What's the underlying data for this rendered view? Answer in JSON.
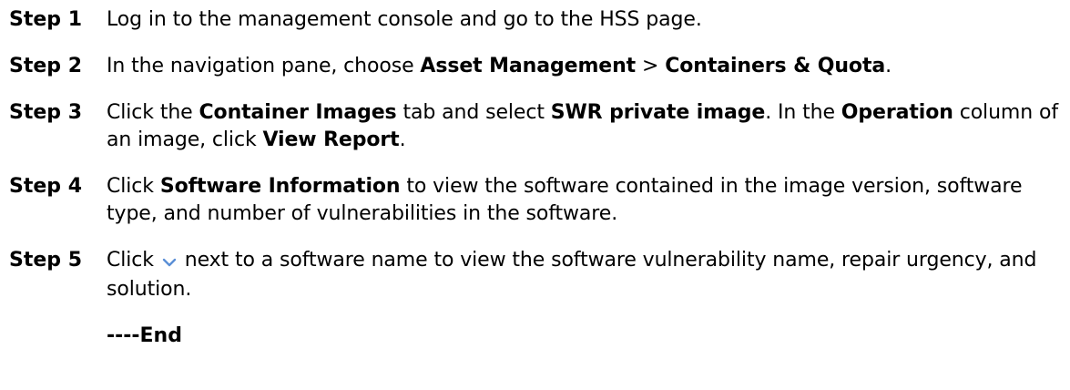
{
  "steps": [
    {
      "label": "Step 1",
      "parts": [
        {
          "t": "Log in to the management console and go to the HSS page.",
          "b": false
        }
      ]
    },
    {
      "label": "Step 2",
      "parts": [
        {
          "t": "In the navigation pane, choose ",
          "b": false
        },
        {
          "t": "Asset Management",
          "b": true
        },
        {
          "t": " > ",
          "b": false
        },
        {
          "t": "Containers & Quota",
          "b": true
        },
        {
          "t": ".",
          "b": false
        }
      ]
    },
    {
      "label": "Step 3",
      "parts": [
        {
          "t": "Click the ",
          "b": false
        },
        {
          "t": "Container Images",
          "b": true
        },
        {
          "t": " tab and select ",
          "b": false
        },
        {
          "t": "SWR private image",
          "b": true
        },
        {
          "t": ". In the ",
          "b": false
        },
        {
          "t": "Operation",
          "b": true
        },
        {
          "t": " column of an image, click ",
          "b": false
        },
        {
          "t": "View Report",
          "b": true
        },
        {
          "t": ".",
          "b": false
        }
      ]
    },
    {
      "label": "Step 4",
      "parts": [
        {
          "t": "Click ",
          "b": false
        },
        {
          "t": "Software Information",
          "b": true
        },
        {
          "t": " to view the software contained in the image version, software type, and number of vulnerabilities in the software.",
          "b": false
        }
      ]
    },
    {
      "label": "Step 5",
      "parts": [
        {
          "t": "Click ",
          "b": false
        },
        {
          "icon": "chevron-down-icon"
        },
        {
          "t": " next to a software name to view the software vulnerability name, repair urgency, and solution.",
          "b": false
        }
      ]
    }
  ],
  "end_text": "----End",
  "colors": {
    "text": "#000000",
    "chevron": "#5b8fd6"
  }
}
